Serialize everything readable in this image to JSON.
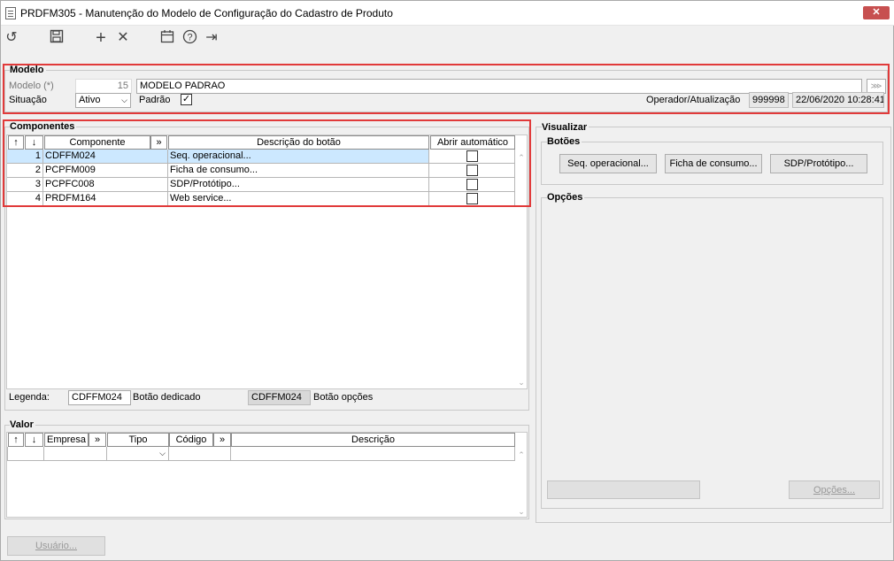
{
  "window": {
    "title": "PRDFM305 - Manutenção do Modelo de Configuração do Cadastro de Produto",
    "close_glyph": "✕"
  },
  "toolbar": {
    "undo_icon": "↺",
    "save_icon": "💾",
    "add_icon": "+",
    "delete_icon": "✕",
    "calendar_icon": "📅",
    "help_icon": "?",
    "exit_icon": "⇥"
  },
  "modelo": {
    "legend": "Modelo",
    "modelo_label": "Modelo (*)",
    "modelo_code": "15",
    "modelo_name": "MODELO PADRAO",
    "situacao_label": "Situação",
    "situacao_value": "Ativo",
    "padrao_label": "Padrão",
    "padrao_checked": "✓",
    "operador_label": "Operador/Atualização",
    "operador_value": "999998",
    "atualizacao_value": "22/06/2020 10:28:41"
  },
  "componentes": {
    "legend": "Componentes",
    "headers": {
      "up": "↑",
      "down": "↓",
      "componente": "Componente",
      "expand": "»",
      "descricao": "Descrição do botão",
      "abrir": "Abrir automático"
    },
    "rows": [
      {
        "num": "1",
        "code": "CDFFM024",
        "desc": "Seq. operacional..."
      },
      {
        "num": "2",
        "code": "PCPFM009",
        "desc": "Ficha de consumo..."
      },
      {
        "num": "3",
        "code": "PCPFC008",
        "desc": "SDP/Protótipo..."
      },
      {
        "num": "4",
        "code": "PRDFM164",
        "desc": "Web service..."
      }
    ],
    "legenda_label": "Legenda:",
    "legenda_dedicado_code": "CDFFM024",
    "legenda_dedicado_text": "Botão dedicado",
    "legenda_opcoes_code": "CDFFM024",
    "legenda_opcoes_text": "Botão opções"
  },
  "valor": {
    "legend": "Valor",
    "headers": {
      "up": "↑",
      "down": "↓",
      "empresa": "Empresa",
      "expand1": "»",
      "tipo": "Tipo",
      "codigo": "Código",
      "expand2": "»",
      "descricao": "Descrição"
    }
  },
  "visualizar": {
    "legend": "Visualizar",
    "botoes_legend": "Botões",
    "buttons": [
      "Seq. operacional...",
      "Ficha de consumo...",
      "SDP/Protótipo..."
    ],
    "opcoes_legend": "Opções",
    "opcoes_button": "Opções..."
  },
  "footer": {
    "usuario_button": "Usuário..."
  }
}
